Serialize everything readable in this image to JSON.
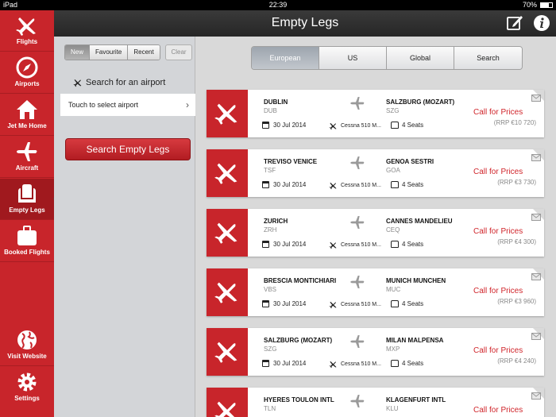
{
  "status_bar": {
    "device": "iPad",
    "time": "22:39",
    "battery": "70%"
  },
  "header": {
    "title": "Empty Legs",
    "accent": "#c8252b"
  },
  "sidebar": {
    "items": [
      {
        "label": "Flights",
        "icon": "plane-icon"
      },
      {
        "label": "Airports",
        "icon": "compass-icon"
      },
      {
        "label": "Jet Me Home",
        "icon": "house-icon"
      },
      {
        "label": "Aircraft",
        "icon": "plane-silhouette-icon"
      },
      {
        "label": "Empty Legs",
        "icon": "seat-icon",
        "active": true
      },
      {
        "label": "Booked Flights",
        "icon": "suitcase-icon"
      },
      {
        "label": "Visit Website",
        "icon": "globe-icon"
      },
      {
        "label": "Settings",
        "icon": "gear-icon"
      }
    ]
  },
  "filter_tabs": [
    "New",
    "Favourite",
    "Recent"
  ],
  "clear_label": "Clear",
  "search_airport_label": "Search for an airport",
  "airport_select_label": "Touch to select airport",
  "search_button": "Search Empty Legs",
  "region_tabs": [
    "European",
    "US",
    "Global",
    "Search"
  ],
  "flights": [
    {
      "from": "DUBLIN",
      "from_code": "DUB",
      "to": "SALZBURG (MOZART)",
      "to_code": "SZG",
      "date": "30 Jul 2014",
      "aircraft": "Cessna 510 M...",
      "seats": "4 Seats",
      "call": "Call for Prices",
      "rrp": "(RRP €10 720)"
    },
    {
      "from": "TREVISO VENICE",
      "from_code": "TSF",
      "to": "GENOA SESTRI",
      "to_code": "GOA",
      "date": "30 Jul 2014",
      "aircraft": "Cessna 510 M...",
      "seats": "4 Seats",
      "call": "Call for Prices",
      "rrp": "(RRP €3 730)"
    },
    {
      "from": "ZURICH",
      "from_code": "ZRH",
      "to": "CANNES MANDELIEU",
      "to_code": "CEQ",
      "date": "30 Jul 2014",
      "aircraft": "Cessna 510 M...",
      "seats": "4 Seats",
      "call": "Call for Prices",
      "rrp": "(RRP €4 300)"
    },
    {
      "from": "BRESCIA MONTICHIARI",
      "from_code": "VBS",
      "to": "MUNICH MUNCHEN",
      "to_code": "MUC",
      "date": "30 Jul 2014",
      "aircraft": "Cessna 510 M...",
      "seats": "4 Seats",
      "call": "Call for Prices",
      "rrp": "(RRP €3 960)"
    },
    {
      "from": "SALZBURG (MOZART)",
      "from_code": "SZG",
      "to": "MILAN MALPENSA",
      "to_code": "MXP",
      "date": "30 Jul 2014",
      "aircraft": "Cessna 510 M...",
      "seats": "4 Seats",
      "call": "Call for Prices",
      "rrp": "(RRP €4 240)"
    },
    {
      "from": "HYERES TOULON INTL",
      "from_code": "TLN",
      "to": "KLAGENFURT INTL",
      "to_code": "KLU",
      "date": "",
      "aircraft": "",
      "seats": "",
      "call": "Call for Prices",
      "rrp": ""
    }
  ]
}
